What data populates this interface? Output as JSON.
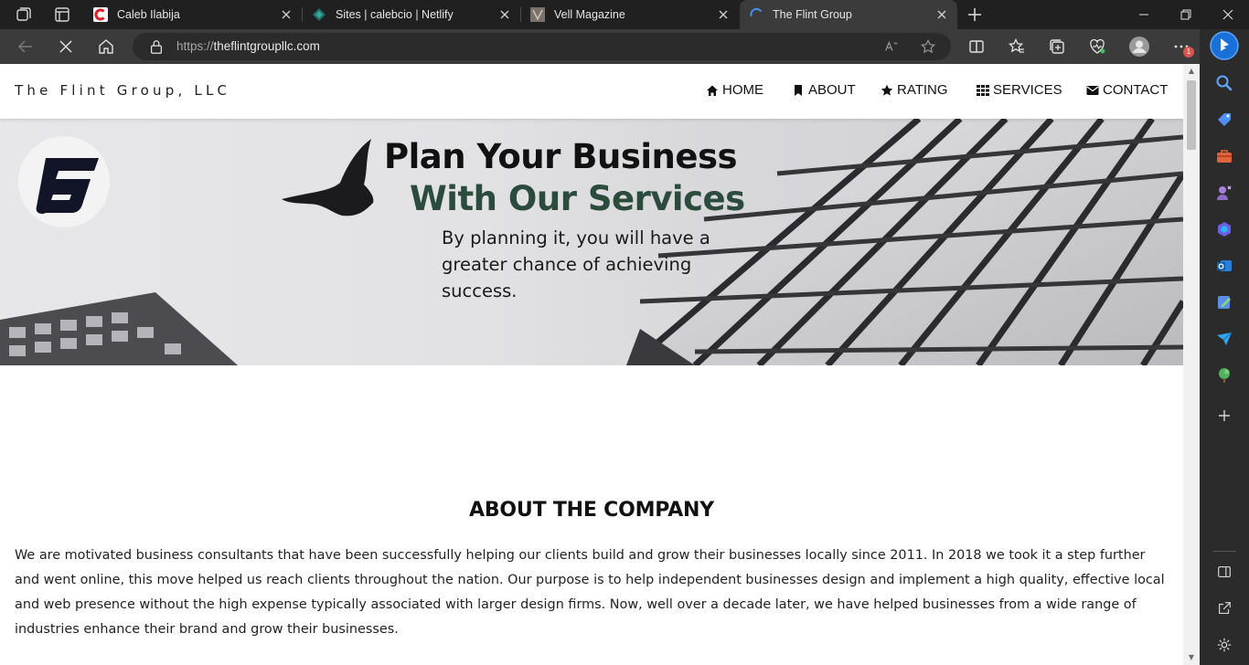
{
  "browser": {
    "tabs": [
      {
        "title": "Caleb Ilabija",
        "favicon": "red-c-icon",
        "active": false
      },
      {
        "title": "Sites | calebcio | Netlify",
        "favicon": "netlify-icon",
        "active": false
      },
      {
        "title": "Vell Magazine",
        "favicon": "vell-icon",
        "active": false
      },
      {
        "title": "The Flint Group",
        "favicon": "loading-spinner-icon",
        "active": true
      }
    ],
    "url": {
      "scheme": "https://",
      "host": "theflintgroupllc.com"
    },
    "notification_badge": "1",
    "accent": "#4b8ef5"
  },
  "site": {
    "brand": "The Flint Group, LLC",
    "nav": [
      {
        "label": "HOME",
        "icon": "home-icon"
      },
      {
        "label": "ABOUT",
        "icon": "bookmark-icon"
      },
      {
        "label": "RATING",
        "icon": "star-icon"
      },
      {
        "label": "SERVICES",
        "icon": "grid-icon"
      },
      {
        "label": "CONTACT",
        "icon": "envelope-icon"
      }
    ],
    "hero": {
      "title_line1": "Plan Your Business",
      "title_line2": "With Our Services",
      "subtitle": "By planning it, you will have a greater chance of achieving success.",
      "accent_color": "#2b4b3c"
    },
    "about": {
      "title": "ABOUT THE COMPANY",
      "text": "We are motivated business consultants that have been successfully helping our clients build and grow their businesses locally since 2011. In 2018 we took it a step further and went online, this move helped us reach clients throughout the nation. Our purpose is to help independent businesses design and implement a high quality, effective local and web presence without the high expense typically associated with larger design firms. Now, well over a decade later, we have helped businesses from a wide range of industries enhance their brand and grow their businesses."
    }
  }
}
